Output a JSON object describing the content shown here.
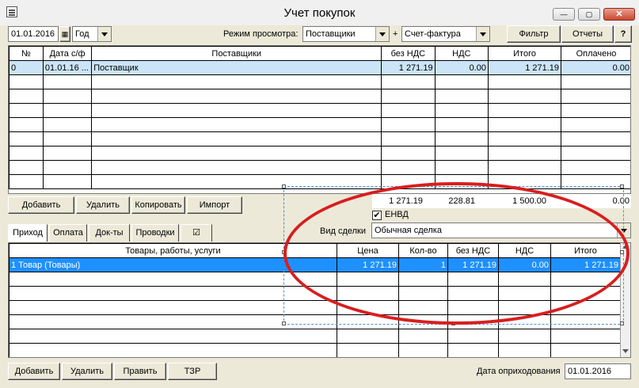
{
  "window": {
    "title": "Учет покупок"
  },
  "toolbar": {
    "date": "01.01.2016",
    "period": "Год",
    "view_mode_label": "Режим просмотра:",
    "view_mode": "Поставщики",
    "plus": "+",
    "doc_type": "Счет-фактура",
    "filter_btn": "Фильтр",
    "reports_btn": "Отчеты",
    "help_btn": "?"
  },
  "top_table": {
    "headers": [
      "№",
      "Дата с/ф",
      "Поставщики",
      "без НДС",
      "НДС",
      "Итого",
      "Оплачено"
    ],
    "rows": [
      [
        "0",
        "01.01.16 ...",
        "Поставщик",
        "1 271.19",
        "0.00",
        "1 271.19",
        "0.00"
      ]
    ],
    "totals": [
      "1 271.19",
      "228.81",
      "1 500.00",
      "0.00"
    ]
  },
  "top_buttons": {
    "add": "Добавить",
    "delete": "Удалить",
    "copy": "Копировать",
    "import": "Импорт"
  },
  "envd": {
    "label": "ЕНВД",
    "checked": "✔"
  },
  "deal": {
    "label": "Вид сделки",
    "value": "Обычная сделка"
  },
  "tabs": {
    "income": "Приход",
    "payment": "Оплата",
    "docs": "Док-ты",
    "postings": "Проводки",
    "check": "☑"
  },
  "bottom_table": {
    "headers": [
      "Товары, работы, услуги",
      "Цена",
      "Кол-во",
      "без НДС",
      "НДС",
      "Итого"
    ],
    "rows": [
      [
        "1 Товар (Товары)",
        "1 271.19",
        "1",
        "1 271.19",
        "0.00",
        "1 271.19"
      ]
    ]
  },
  "bottom_buttons": {
    "add": "Добавить",
    "delete": "Удалить",
    "edit": "Править",
    "tzr": "ТЗР"
  },
  "receipt": {
    "label": "Дата оприходования",
    "date": "01.01.2016"
  },
  "colors": {
    "annotation": "#d81e1e",
    "selection": "#1e90ff"
  }
}
